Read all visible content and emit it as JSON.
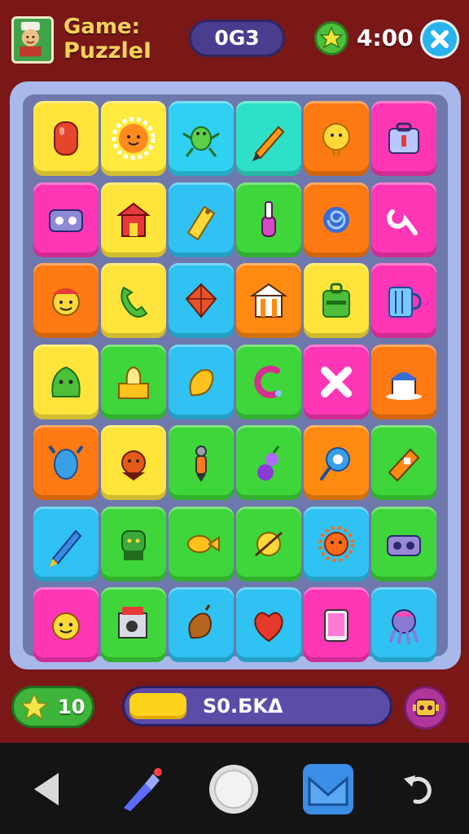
{
  "header": {
    "title_line1": "Game:",
    "title_line2": "PuzzleI",
    "score": "0G3",
    "timer": "4:00"
  },
  "board": {
    "tiles": [
      {
        "color": "#ffe53b",
        "icon": "red-capsule-icon"
      },
      {
        "color": "#ffea3e",
        "icon": "orange-sun-face-icon"
      },
      {
        "color": "#2fd0f2",
        "icon": "green-bug-icon"
      },
      {
        "color": "#2fe0c8",
        "icon": "pencil-icon"
      },
      {
        "color": "#ff7a12",
        "icon": "yellow-chick-icon"
      },
      {
        "color": "#ff36b5",
        "icon": "suitcase-icon"
      },
      {
        "color": "#ff36b5",
        "icon": "robot-card-icon"
      },
      {
        "color": "#ffe53b",
        "icon": "house-lantern-icon"
      },
      {
        "color": "#2fc2f2",
        "icon": "yellow-tag-icon"
      },
      {
        "color": "#3ed63a",
        "icon": "nail-polish-icon"
      },
      {
        "color": "#ff7a12",
        "icon": "blue-snail-icon"
      },
      {
        "color": "#ff36b5",
        "icon": "wrench-icon"
      },
      {
        "color": "#ff7a12",
        "icon": "smiley-hat-icon"
      },
      {
        "color": "#ffe53b",
        "icon": "phone-icon"
      },
      {
        "color": "#2fc2f2",
        "icon": "red-kite-icon"
      },
      {
        "color": "#ff8a12",
        "icon": "temple-icon"
      },
      {
        "color": "#ffe53b",
        "icon": "green-luggage-icon"
      },
      {
        "color": "#ff36b5",
        "icon": "blue-mug-icon"
      },
      {
        "color": "#ffe53b",
        "icon": "green-blob-icon"
      },
      {
        "color": "#3ed63a",
        "icon": "tissue-box-icon"
      },
      {
        "color": "#2fc2f2",
        "icon": "yellow-bean-icon"
      },
      {
        "color": "#3ed63a",
        "icon": "magenta-hook-icon"
      },
      {
        "color": "#ff36b5",
        "icon": "white-cross-icon"
      },
      {
        "color": "#ff7a12",
        "icon": "mini-house-icon"
      },
      {
        "color": "#ff7a12",
        "icon": "blue-owl-icon"
      },
      {
        "color": "#ffe53b",
        "icon": "orange-bird-icon"
      },
      {
        "color": "#3ed63a",
        "icon": "tool-pen-icon"
      },
      {
        "color": "#3ed63a",
        "icon": "purple-gourd-icon"
      },
      {
        "color": "#ff8a12",
        "icon": "blue-pin-icon"
      },
      {
        "color": "#3ed63a",
        "icon": "orange-stapler-icon"
      },
      {
        "color": "#2fc2f2",
        "icon": "blue-pencil-icon"
      },
      {
        "color": "#3ed63a",
        "icon": "green-goblin-icon"
      },
      {
        "color": "#3ed63a",
        "icon": "yellow-fish-icon"
      },
      {
        "color": "#3ed63a",
        "icon": "yellow-planet-icon"
      },
      {
        "color": "#2fc2f2",
        "icon": "orange-sun-icon"
      },
      {
        "color": "#3ed63a",
        "icon": "purple-robot-icon"
      },
      {
        "color": "#ff36b5",
        "icon": "yellow-face-icon"
      },
      {
        "color": "#3ed63a",
        "icon": "camera-box-icon"
      },
      {
        "color": "#2fc2f2",
        "icon": "brown-bean-icon"
      },
      {
        "color": "#2fc2f2",
        "icon": "red-heart-leaf-icon"
      },
      {
        "color": "#ff36b5",
        "icon": "tablet-icon"
      },
      {
        "color": "#2fc2f2",
        "icon": "purple-octopus-icon"
      }
    ]
  },
  "footer": {
    "combo": "10",
    "progress": 0.22,
    "progress_label": "S0.БKΔ"
  },
  "nav": {
    "back_icon": "back-triangle-icon",
    "pen_icon": "brush-icon",
    "home_icon": "home-circle-icon",
    "mail_icon": "mail-icon",
    "undo_icon": "undo-icon"
  }
}
